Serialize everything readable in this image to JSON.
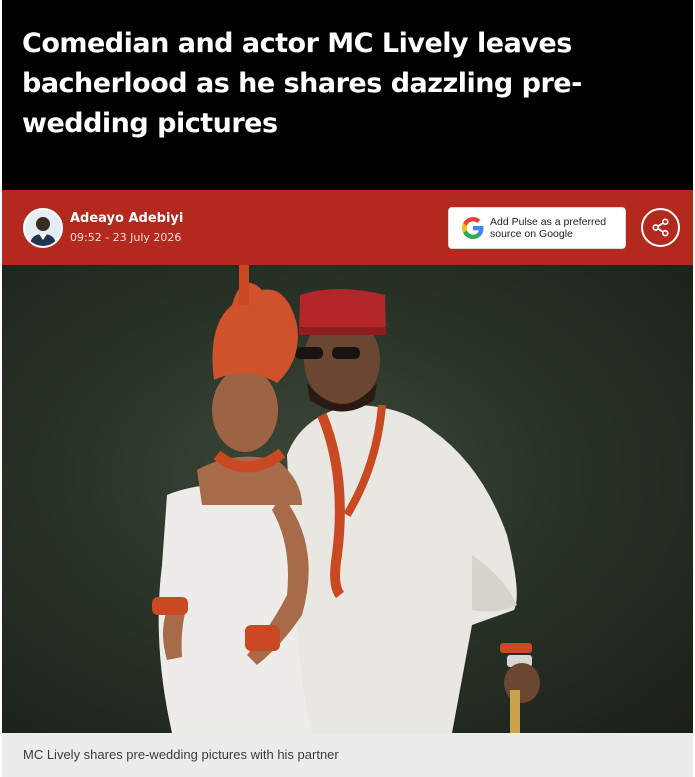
{
  "article": {
    "title": "Comedian and actor MC Lively leaves bacherlood as he shares dazzling pre-wedding pictures"
  },
  "author": {
    "name": "Adeayo Adebiyi",
    "timestamp": "09:52 - 23 July 2026"
  },
  "google_button": {
    "label": "Add Pulse as a preferred source on Google",
    "icon": "google-g-icon"
  },
  "share_button": {
    "icon": "share-icon"
  },
  "photo": {
    "caption": "MC Lively shares pre-wedding pictures with his partner"
  },
  "colors": {
    "title_bg": "#000000",
    "author_bar_bg": "#b4291d",
    "caption_bg": "#ececec"
  }
}
